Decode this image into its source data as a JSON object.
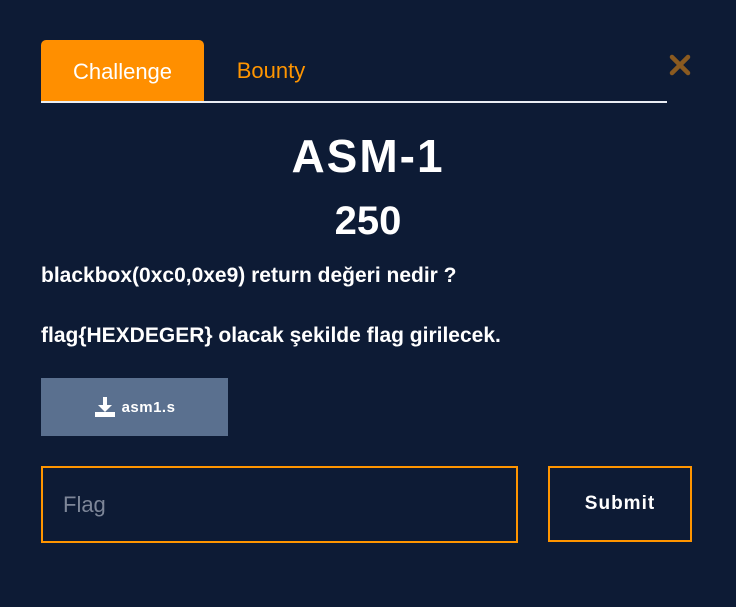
{
  "tabs": [
    {
      "label": "Challenge",
      "active": true
    },
    {
      "label": "Bounty",
      "active": false
    }
  ],
  "close_icon": "close-icon",
  "challenge": {
    "title": "ASM-1",
    "points": "250",
    "description_line1": "blackbox(0xc0,0xe9) return değeri nedir ?",
    "description_line2": "flag{HEXDEGER} olacak şekilde flag girilecek."
  },
  "download": {
    "icon": "download-icon",
    "label": "asm1.s"
  },
  "flag_field": {
    "placeholder": "Flag",
    "value": ""
  },
  "submit": {
    "label": "Submit"
  },
  "colors": {
    "background": "#0d1b35",
    "accent": "#ff8f00",
    "download_button": "#5a708f",
    "close_icon": "#8a5a20"
  }
}
